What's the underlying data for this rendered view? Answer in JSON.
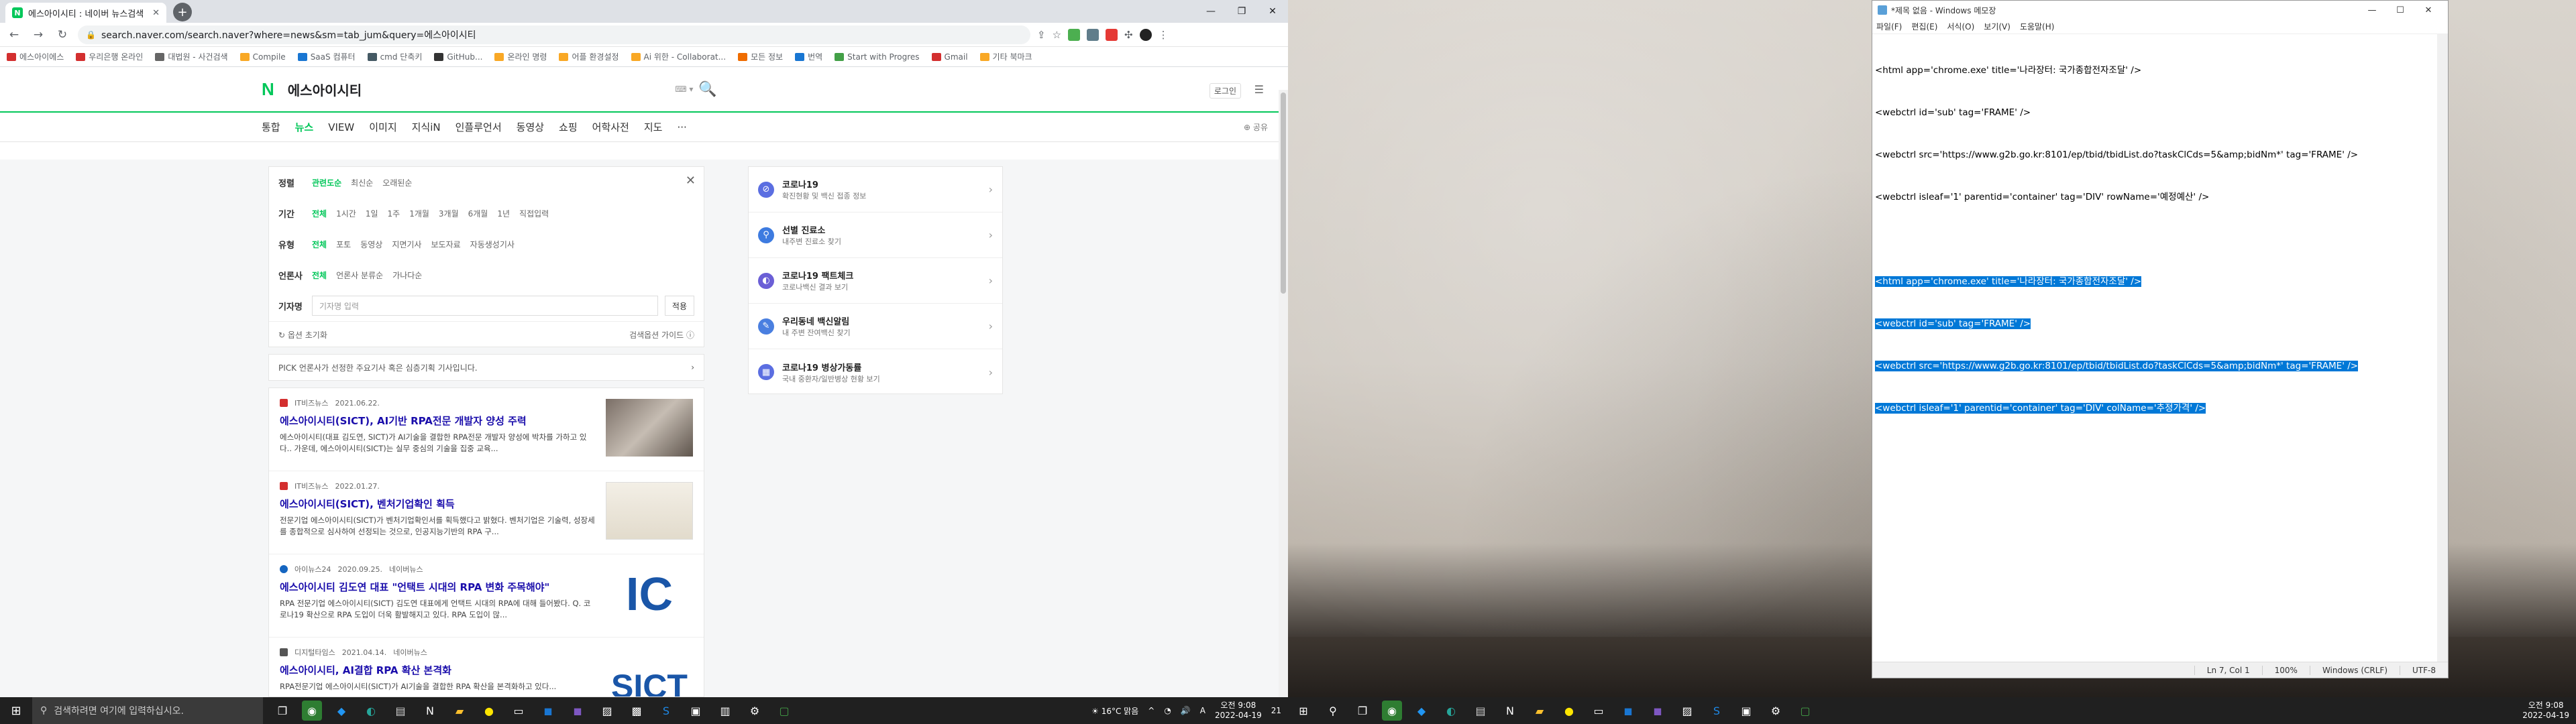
{
  "browser": {
    "tab_title": "에스아이시티 : 네이버 뉴스검색",
    "tab_favicon": "N",
    "new_tab_label": "+",
    "url": "search.naver.com/search.naver?where=news&sm=tab_jum&query=에스아이시티",
    "window_controls": [
      "—",
      "❐",
      "✕"
    ],
    "bookmarks": [
      "에스아이에스",
      "우리은행 온라인",
      "대법원 - 사건검색",
      "Compile",
      "SaaS 컴퓨터",
      "cmd 단축키",
      "GitHub...",
      "온라인 명령",
      "어플 환경설정",
      "Ai 위한 - Collaborat...",
      "모든 정보",
      "번역",
      "Start with Progres",
      "Gmail",
      "기타 북마크"
    ]
  },
  "naver": {
    "logo": "N",
    "query": "에스아이시티",
    "login_label": "로그인",
    "tabs": [
      "통합",
      "뉴스",
      "VIEW",
      "이미지",
      "지식iN",
      "인플루언서",
      "동영상",
      "쇼핑",
      "어학사전",
      "지도",
      "···"
    ],
    "share_label": "공유",
    "options": {
      "rows": [
        {
          "label": "정렬",
          "opts": [
            "관련도순",
            "최신순",
            "오래된순"
          ]
        },
        {
          "label": "기간",
          "opts": [
            "전체",
            "1시간",
            "1일",
            "1주",
            "1개월",
            "3개월",
            "6개월",
            "1년",
            "직접입력"
          ]
        },
        {
          "label": "유형",
          "opts": [
            "전체",
            "포토",
            "동영상",
            "지면기사",
            "보도자료",
            "자동생성기사"
          ]
        },
        {
          "label": "언론사",
          "opts": [
            "전체",
            "언론사 분류순",
            "가나다순"
          ]
        }
      ],
      "reporter_label": "기자명",
      "reporter_placeholder": "기자명 입력",
      "reporter_button": "적용",
      "reset_label": "옵션 초기화",
      "guide_label": "검색옵션 가이드"
    },
    "pick_text": "PICK 언론사가 선정한 주요기사 혹은 심층기획 기사입니다.",
    "news": [
      {
        "source": "IT비즈뉴스",
        "date": "2021.06.22.",
        "title": "에스아이시티(SICT), AI기반 RPA전문 개발자 양성 주력",
        "desc": "에스아이시티(대표 김도연, SICT)가 AI기술을 결합한 RPA전문 개발자 양성에 박차를 가하고 있다.. 가운데, 에스아이시티(SICT)는 실무 중심의 기술을 집중 교육..."
      },
      {
        "source": "IT비즈뉴스",
        "date": "2022.01.27.",
        "title": "에스아이시티(SICT), 벤처기업확인 획득",
        "desc": "전문기업 에스아이시티(SICT)가 벤처기업확인서를 획득했다고 밝혔다. 벤처기업은 기술력, 성장세를 종합적으로 심사하여 선정되는 것으로, 인공지능기반의 RPA 구..."
      },
      {
        "source": "아이뉴스24",
        "date": "2020.09.25.",
        "title": "에스아이시티 김도연 대표 \"언택트 시대의 RPA 변화 주목해야\"",
        "desc": "RPA 전문기업 에스아이시티(SICT) 김도연 대표에게 언택트 시대의 RPA에 대해 들어봤다. Q. 코로나19 확산으로 RPA 도입이 더욱 활발해지고 있다. RPA 도입이 많..."
      },
      {
        "source": "디지털타임스",
        "date": "2021.04.14.",
        "title": "에스아이시티, AI결합 RPA 확산 본격화",
        "desc": "RPA전문기업 에스아이시티(SICT)가 AI기술을 결합한 RPA 확산을 본격화하고 있다..."
      }
    ],
    "news_naver_label": "네이버뉴스",
    "side": [
      {
        "title": "코로나19",
        "sub": "확진현황 및 백신 접종 정보"
      },
      {
        "title": "선별 진료소",
        "sub": "내주변 진료소 찾기"
      },
      {
        "title": "코로나19 팩트체크",
        "sub": "코로나백신 결과 보기"
      },
      {
        "title": "우리동네 백신알림",
        "sub": "내 주변 잔여백신 찾기"
      },
      {
        "title": "코로나19 병상가동률",
        "sub": "국내 중환자/일반병상 현황 보기"
      }
    ]
  },
  "taskbar1": {
    "search_placeholder": "검색하려면 여기에 입력하십시오.",
    "weather": "16°C 맑음",
    "time": "오전 9:08",
    "date": "2022-04-19",
    "badge": "21"
  },
  "notepad": {
    "title": "*제목 없음 - Windows 메모장",
    "menus": [
      "파일(F)",
      "편집(E)",
      "서식(O)",
      "보기(V)",
      "도움말(H)"
    ],
    "lines": [
      "<html app='chrome.exe' title='나라장터: 국가종합전자조달' />",
      "<webctrl id='sub' tag='FRAME' />",
      "<webctrl src='https://www.g2b.go.kr:8101/ep/tbid/tbidList.do?taskClCds=5&amp;bidNm*' tag='FRAME' />",
      "<webctrl isleaf='1' parentid='container' tag='DIV' rowName='예정예산' />",
      "",
      "<html app='chrome.exe' title='나라장터: 국가종합전자조달' />",
      "<webctrl id='sub' tag='FRAME' />",
      "<webctrl src='https://www.g2b.go.kr:8101/ep/tbid/tbidList.do?taskClCds=5&amp;bidNm*' tag='FRAME' />",
      "<webctrl isleaf='1' parentid='container' tag='DIV' colName='추정가격' />"
    ],
    "status": {
      "pos": "Ln 7, Col 1",
      "zoom": "100%",
      "eol": "Windows (CRLF)",
      "enc": "UTF-8"
    }
  },
  "taskbar2": {
    "time": "오전 9:08",
    "date": "2022-04-19"
  }
}
